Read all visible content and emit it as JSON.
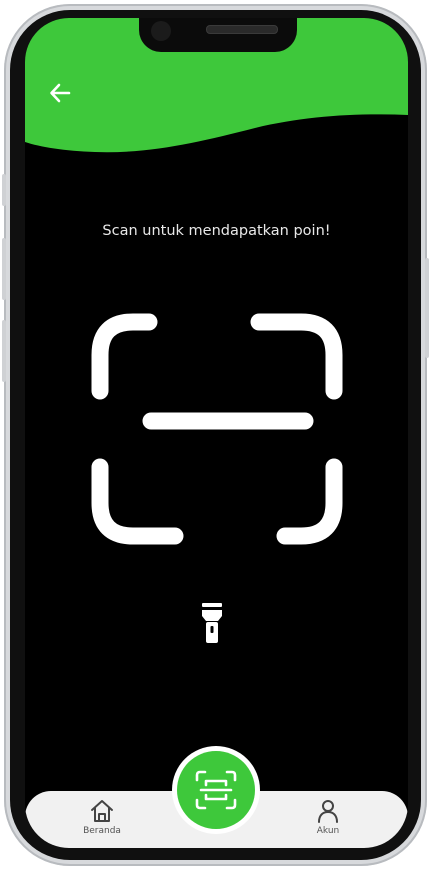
{
  "colors": {
    "accent": "#3ec83b",
    "background": "#000000",
    "nav_background": "#f1f1f1"
  },
  "header": {
    "back_icon": "arrow-left-icon"
  },
  "scanner": {
    "prompt": "Scan untuk mendapatkan poin!",
    "frame_icon": "scan-frame-icon",
    "torch_icon": "flashlight-icon"
  },
  "bottom_nav": {
    "items": [
      {
        "label": "Beranda",
        "icon": "home-icon"
      },
      {
        "label": "Akun",
        "icon": "user-icon"
      }
    ],
    "fab_icon": "qr-scan-icon"
  }
}
